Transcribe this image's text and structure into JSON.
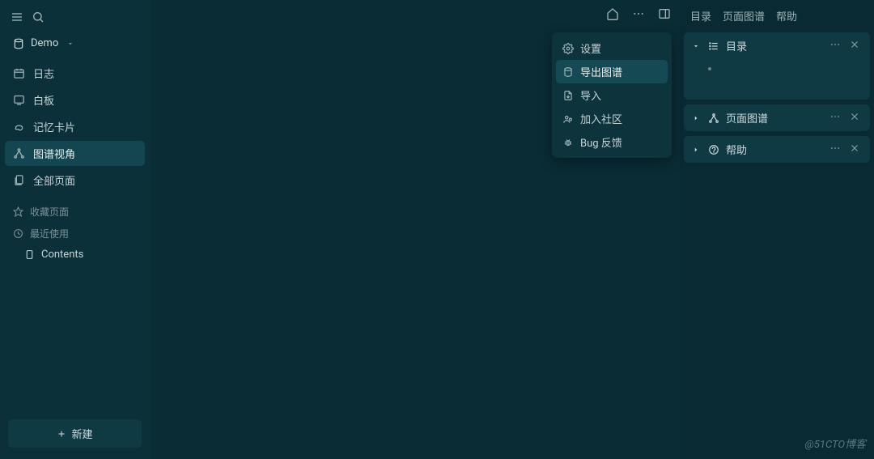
{
  "sidebar": {
    "project_name": "Demo",
    "nav": [
      {
        "label": "日志",
        "icon": "calendar-icon"
      },
      {
        "label": "白板",
        "icon": "whiteboard-icon"
      },
      {
        "label": "记忆卡片",
        "icon": "cards-icon"
      },
      {
        "label": "图谱视角",
        "icon": "graph-icon",
        "active": true
      },
      {
        "label": "全部页面",
        "icon": "pages-icon"
      }
    ],
    "small": [
      {
        "label": "收藏页面",
        "icon": "star-icon"
      },
      {
        "label": "最近使用",
        "icon": "clock-icon"
      }
    ],
    "content_item": "Contents",
    "new_btn": "新建"
  },
  "dropdown": {
    "items": [
      {
        "label": "设置",
        "icon": "gear-icon"
      },
      {
        "label": "导出图谱",
        "icon": "export-icon",
        "active": true
      },
      {
        "label": "导入",
        "icon": "import-icon"
      },
      {
        "label": "加入社区",
        "icon": "community-icon"
      },
      {
        "label": "Bug 反馈",
        "icon": "bug-icon"
      }
    ]
  },
  "rightpanel": {
    "tabs": [
      "目录",
      "页面图谱",
      "帮助"
    ],
    "cards": [
      {
        "title": "目录",
        "icon": "list-icon",
        "expanded": true
      },
      {
        "title": "页面图谱",
        "icon": "graph-icon",
        "expanded": false
      },
      {
        "title": "帮助",
        "icon": "help-icon",
        "expanded": false
      }
    ]
  },
  "watermark": "@51CTO博客"
}
